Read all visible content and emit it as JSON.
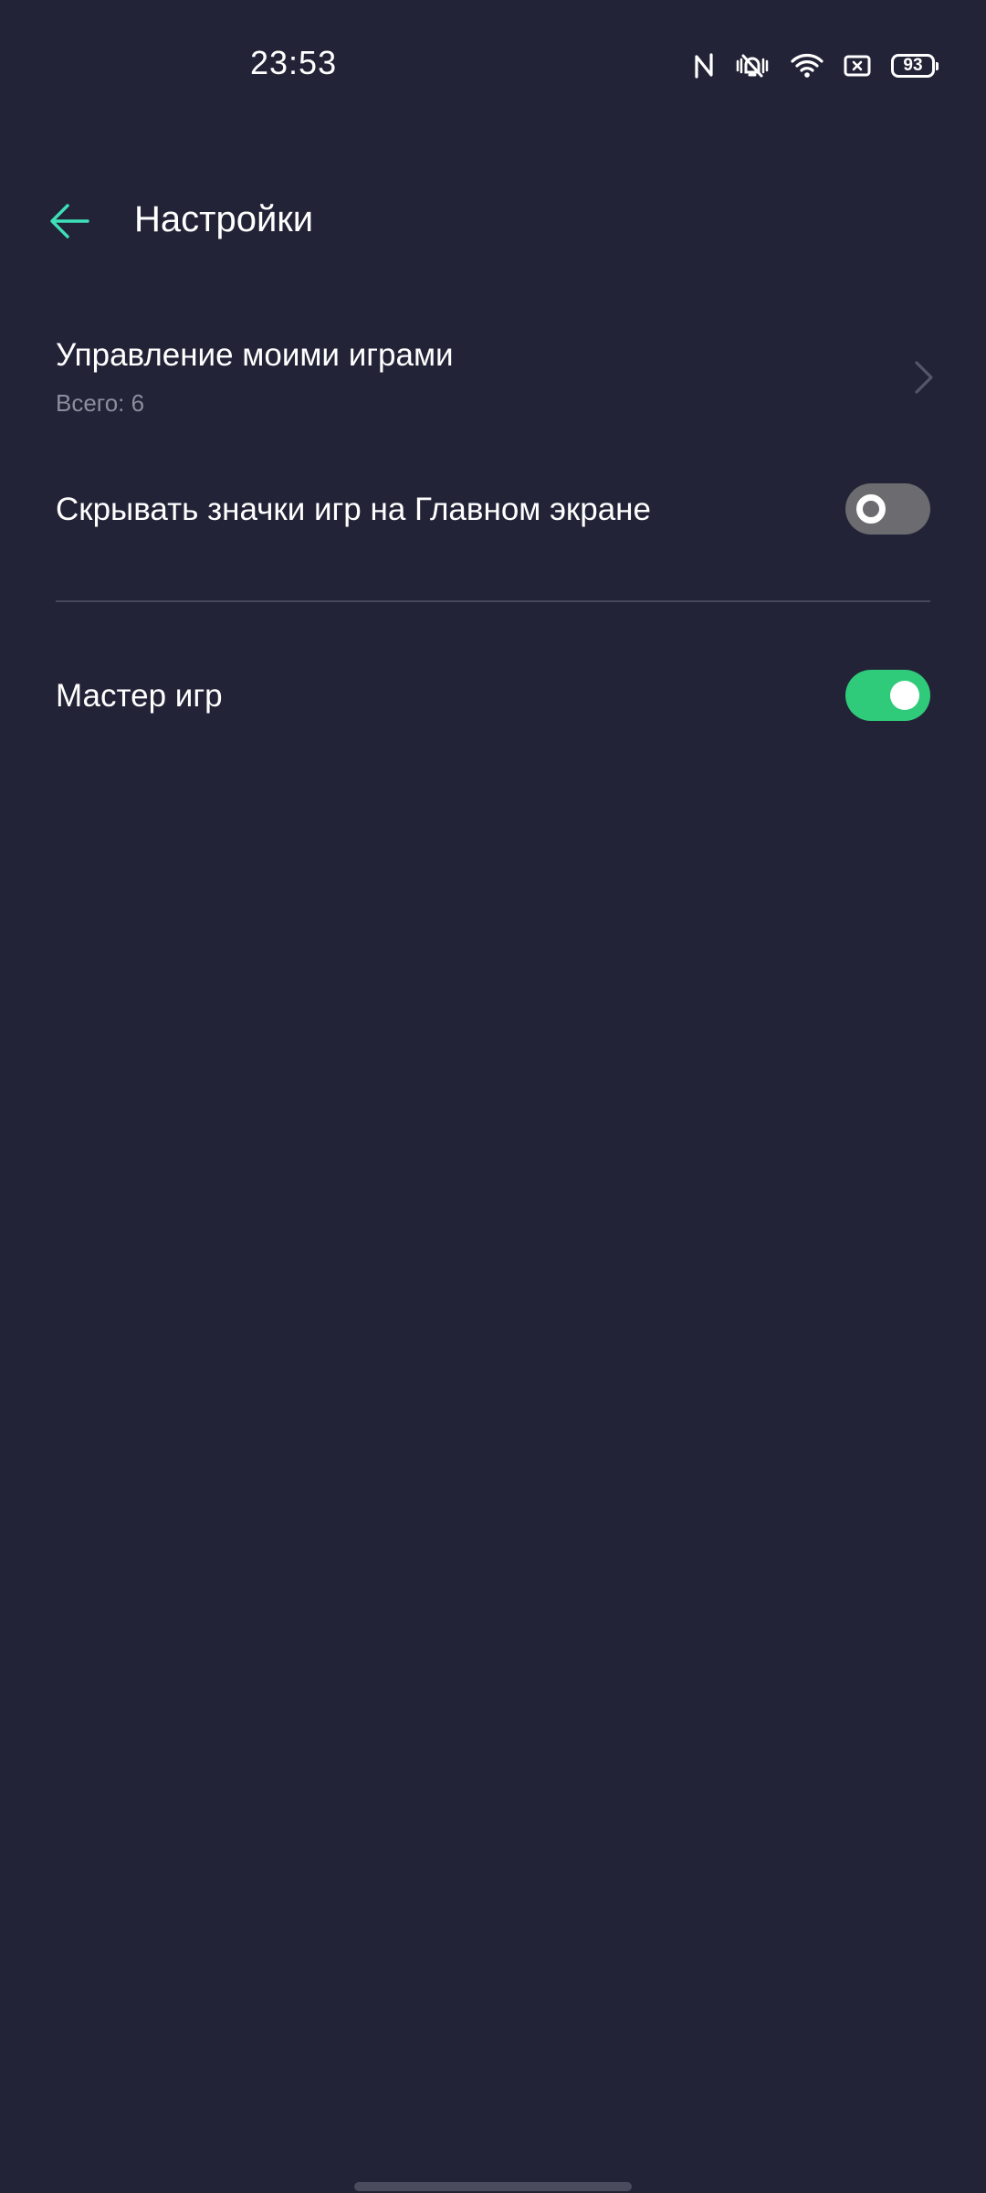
{
  "status_bar": {
    "time": "23:53",
    "battery": "93",
    "icons": [
      "nfc-icon",
      "vibrate-mute-icon",
      "wifi-icon",
      "sim-off-icon",
      "battery-icon"
    ]
  },
  "header": {
    "back_icon": "arrow-left-icon",
    "title": "Настройки"
  },
  "settings": {
    "manage_games": {
      "title": "Управление моими играми",
      "subtitle": "Всего: 6",
      "icon": "chevron-right-icon"
    },
    "hide_icons": {
      "title": "Скрывать значки игр на Главном экране",
      "enabled": false
    },
    "game_master": {
      "title": "Мастер игр",
      "enabled": true
    }
  },
  "colors": {
    "background": "#222337",
    "accent": "#2fcb7a",
    "back_arrow": "#3ee0b8",
    "toggle_off": "#6b6b70"
  }
}
